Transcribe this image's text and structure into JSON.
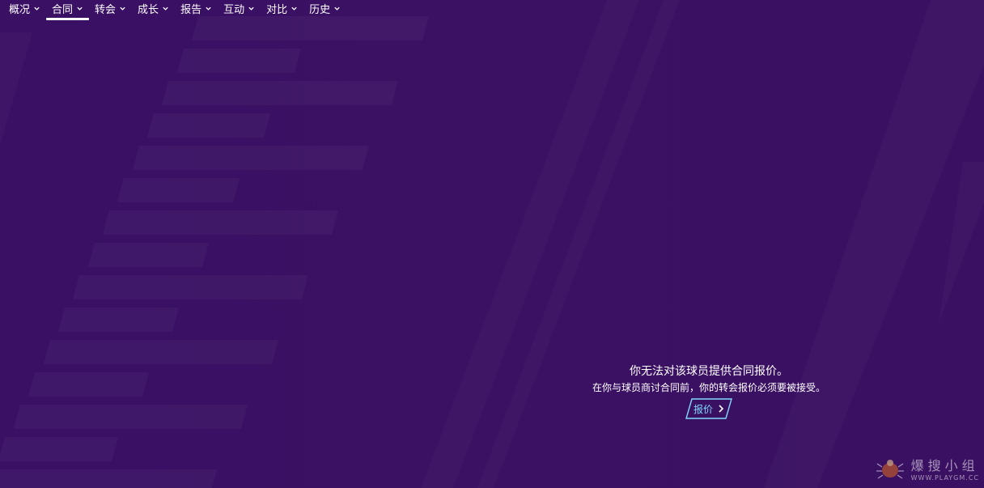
{
  "nav": {
    "tabs": [
      {
        "label": "概况",
        "active": false
      },
      {
        "label": "合同",
        "active": true
      },
      {
        "label": "转会",
        "active": false
      },
      {
        "label": "成长",
        "active": false
      },
      {
        "label": "报告",
        "active": false
      },
      {
        "label": "互动",
        "active": false
      },
      {
        "label": "对比",
        "active": false
      },
      {
        "label": "历史",
        "active": false
      }
    ]
  },
  "message": {
    "title": "你无法对该球员提供合同报价。",
    "subtitle": "在你与球员商讨合同前，你的转会报价必须要被接受。",
    "button_label": "报价"
  },
  "watermark": {
    "cn": "爆搜小组",
    "en": "WWW.PLAYGM.CC",
    "logo": "bug-logo"
  },
  "colors": {
    "background": "#3a1163",
    "active_underline": "#ffffff",
    "button_accent": "#7fd8ff"
  }
}
